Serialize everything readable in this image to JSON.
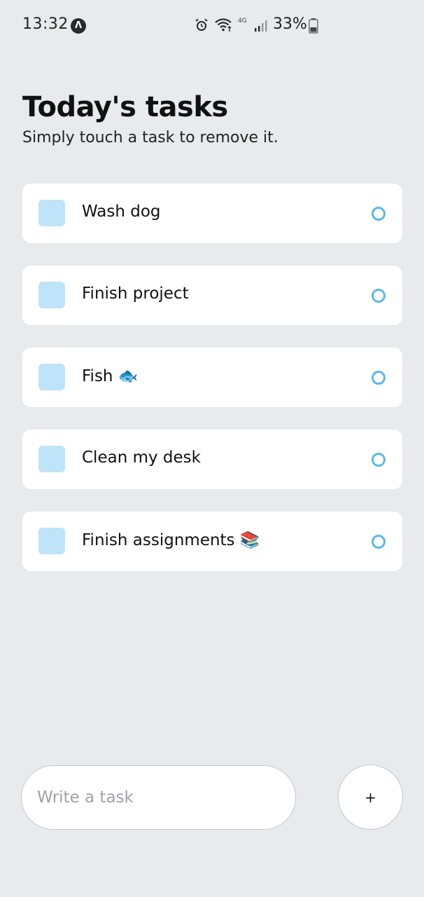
{
  "status_bar": {
    "time": "13:32",
    "network": "4G",
    "battery": "33%",
    "icons": [
      "app-notification-icon",
      "alarm-icon",
      "wifi-icon",
      "signal-icon",
      "battery-icon"
    ]
  },
  "header": {
    "title": "Today's tasks",
    "subtitle": "Simply touch a task to remove it."
  },
  "tasks": [
    {
      "text": "Wash dog"
    },
    {
      "text": "Finish project"
    },
    {
      "text": "Fish 🐟"
    },
    {
      "text": "Clean my desk"
    },
    {
      "text": "Finish assignments 📚"
    }
  ],
  "composer": {
    "placeholder": "Write a task",
    "value": "",
    "add_label": "+"
  },
  "colors": {
    "background": "#e8eaed",
    "card": "#ffffff",
    "square": "#bfe3f8",
    "circle": "#5cb8e6"
  }
}
